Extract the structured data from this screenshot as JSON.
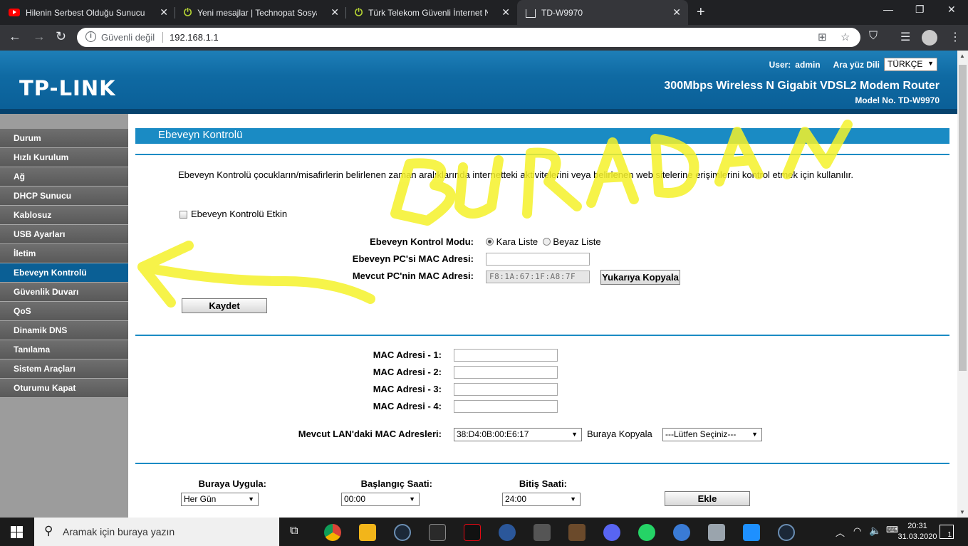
{
  "browser": {
    "tabs": [
      {
        "title": "Hilenin Serbest Olduğu Sunucudaki",
        "icon": "youtube-icon"
      },
      {
        "title": "Yeni mesajlar | Technopat Sosyal",
        "icon": "power-icon"
      },
      {
        "title": "Türk Telekom Güvenli İnternet Nasıl",
        "icon": "power-icon"
      },
      {
        "title": "TD-W9970",
        "icon": "router-icon"
      }
    ],
    "security_label": "Güvenli değil",
    "url": "192.168.1.1"
  },
  "router": {
    "logo": "TP-LINK",
    "user_label": "User:",
    "user_name": "admin",
    "lang_label": "Ara yüz Dili",
    "lang_value": "TÜRKÇE",
    "product_name": "300Mbps Wireless N Gigabit VDSL2 Modem Router",
    "model_no": "Model No. TD-W9970"
  },
  "sidebar": {
    "items": [
      {
        "label": "Durum"
      },
      {
        "label": "Hızlı Kurulum"
      },
      {
        "label": "Ağ"
      },
      {
        "label": "DHCP Sunucu"
      },
      {
        "label": "Kablosuz"
      },
      {
        "label": "USB Ayarları"
      },
      {
        "label": "İletim"
      },
      {
        "label": "Ebeveyn Kontrolü"
      },
      {
        "label": "Güvenlik Duvarı"
      },
      {
        "label": "QoS"
      },
      {
        "label": "Dinamik DNS"
      },
      {
        "label": "Tanılama"
      },
      {
        "label": "Sistem Araçları"
      },
      {
        "label": "Oturumu Kapat"
      }
    ],
    "active_index": 7
  },
  "page": {
    "title": "Ebeveyn Kontrolü",
    "description": "Ebeveyn Kontrolü çocukların/misafirlerin belirlenen zaman aralıklarında internetteki aktivitelerini veya belirlenen web sitelerine erişimlerini kontrol etmek için kullanılır.",
    "enable_label": "Ebeveyn Kontrolü Etkin",
    "mode_label": "Ebeveyn Kontrol Modu:",
    "mode_black": "Kara Liste",
    "mode_white": "Beyaz Liste",
    "parent_mac_label": "Ebeveyn PC'si MAC Adresi:",
    "parent_mac_value": "",
    "current_mac_label": "Mevcut PC'nin MAC Adresi:",
    "current_mac_value": "F8:1A:67:1F:A8:7F",
    "copy_up_label": "Yukarıya Kopyala",
    "save_label": "Kaydet",
    "mac1_label": "MAC Adresi - 1:",
    "mac2_label": "MAC Adresi - 2:",
    "mac3_label": "MAC Adresi - 3:",
    "mac4_label": "MAC Adresi - 4:",
    "lan_mac_label": "Mevcut LAN'daki MAC Adresleri:",
    "lan_mac_value": "38:D4:0B:00:E6:17",
    "copy_here_label": "Buraya Kopyala",
    "copy_here_value": "---Lütfen Seçiniz---",
    "apply_label": "Buraya Uygula:",
    "apply_value": "Her Gün",
    "start_label": "Başlangıç Saati:",
    "start_value": "00:00",
    "end_label": "Bitiş Saati:",
    "end_value": "24:00",
    "add_label": "Ekle"
  },
  "overlay": {
    "scribble_text": "BURADAN",
    "color": "#f5f22a"
  },
  "taskbar": {
    "search_placeholder": "Aramak için buraya yazın",
    "time": "20:31",
    "date": "31.03.2020",
    "notif_count": "1"
  }
}
